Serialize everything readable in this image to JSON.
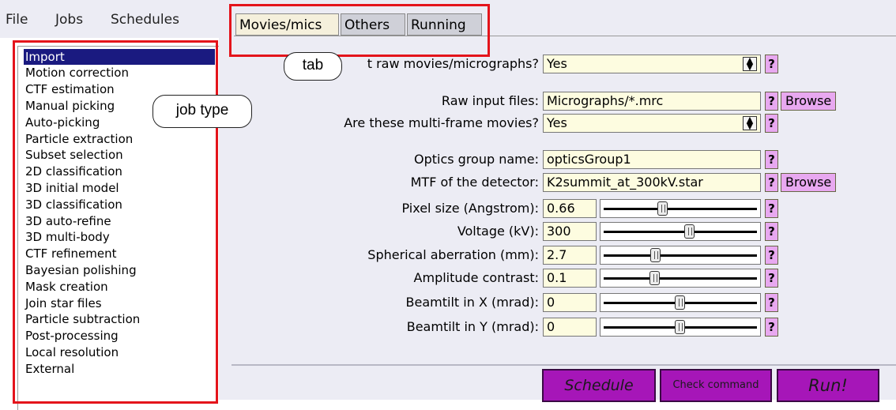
{
  "menubar": {
    "file": "File",
    "jobs": "Jobs",
    "schedules": "Schedules"
  },
  "jobs": [
    "Import",
    "Motion correction",
    "CTF estimation",
    "Manual picking",
    "Auto-picking",
    "Particle extraction",
    "Subset selection",
    "2D classification",
    "3D initial model",
    "3D classification",
    "3D auto-refine",
    "3D multi-body",
    "CTF refinement",
    "Bayesian polishing",
    "Mask creation",
    "Join star files",
    "Particle subtraction",
    "Post-processing",
    "Local resolution",
    "External"
  ],
  "tabs": {
    "movies": "Movies/mics",
    "others": "Others",
    "running": "Running"
  },
  "callouts": {
    "tab": "tab",
    "job_type": "job type"
  },
  "form": {
    "import_label": "t raw movies/micrographs?",
    "import_value": "Yes",
    "raw_label": "Raw input files:",
    "raw_value": "Micrographs/*.mrc",
    "multiframe_label": "Are these multi-frame movies?",
    "multiframe_value": "Yes",
    "optics_label": "Optics group name:",
    "optics_value": "opticsGroup1",
    "mtf_label": "MTF of the detector:",
    "mtf_value": "K2summit_at_300kV.star",
    "pixel_label": "Pixel size (Angstrom):",
    "pixel_value": "0.66",
    "voltage_label": "Voltage (kV):",
    "voltage_value": "300",
    "cs_label": "Spherical aberration (mm):",
    "cs_value": "2.7",
    "amp_label": "Amplitude contrast:",
    "amp_value": "0.1",
    "tiltx_label": "Beamtilt in X (mrad):",
    "tiltx_value": "0",
    "tilty_label": "Beamtilt in Y (mrad):",
    "tilty_value": "0"
  },
  "help_label": "?",
  "browse_label": "Browse",
  "buttons": {
    "schedule": "Schedule",
    "check": "Check command",
    "run": "Run!"
  },
  "colors": {
    "accent": "#a616b8",
    "help": "#e8a8f0",
    "selected": "#1a1a80",
    "highlight": "#e4141b"
  }
}
